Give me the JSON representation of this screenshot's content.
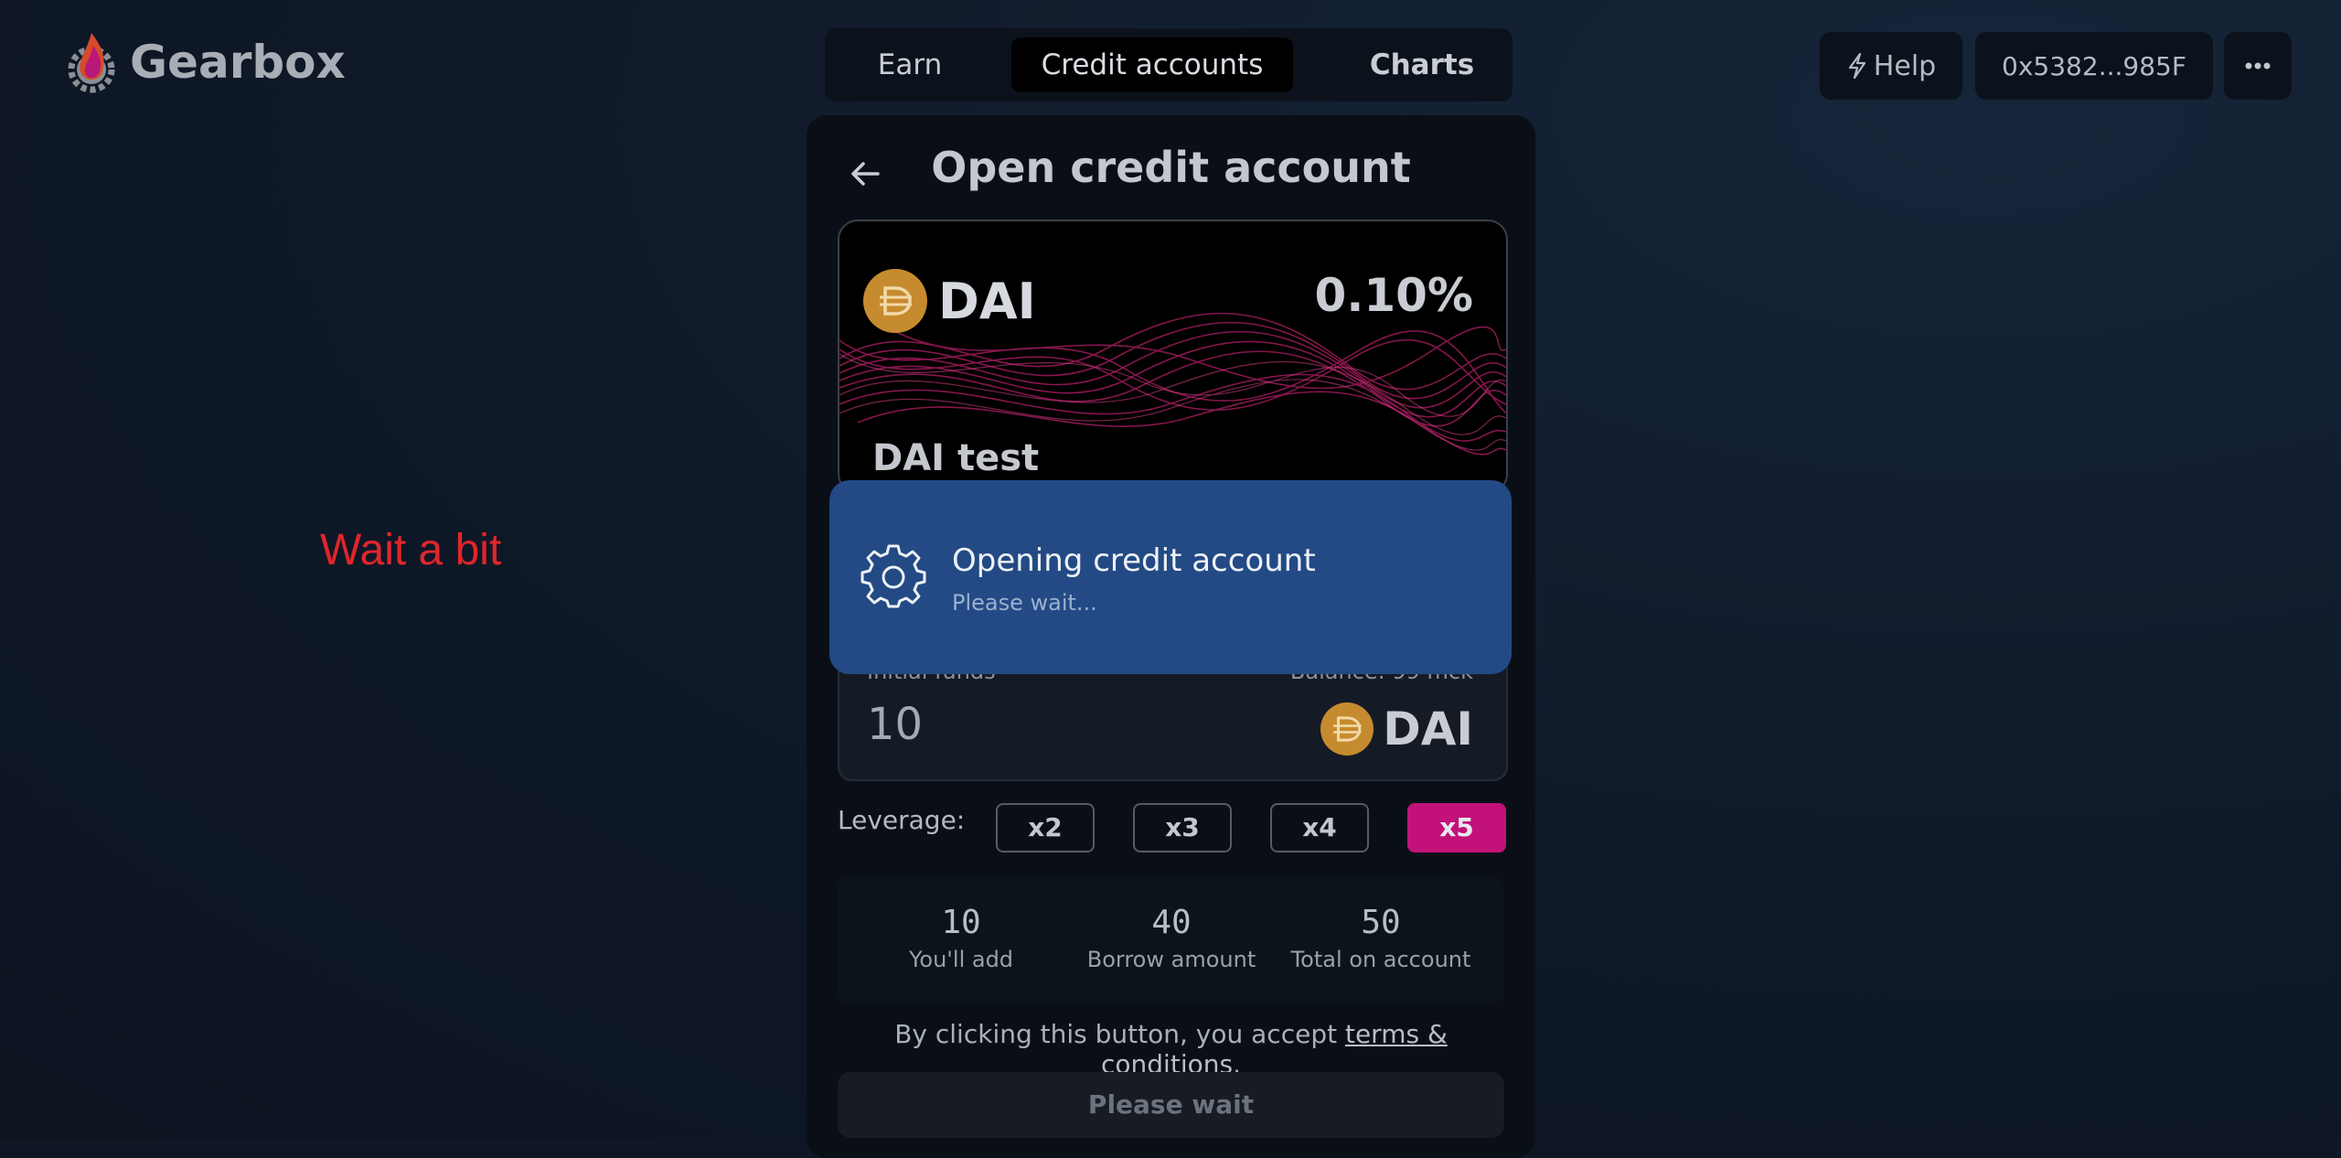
{
  "app": {
    "name": "Gearbox"
  },
  "nav": {
    "tabs": [
      "Earn",
      "Credit accounts",
      "Charts"
    ],
    "active": "Credit accounts"
  },
  "header": {
    "help_label": "Help",
    "wallet_address": "0x5382...985F"
  },
  "annotation": {
    "text": "Wait a bit"
  },
  "panel": {
    "title": "Open credit account",
    "card": {
      "token": "DAI",
      "rate": "0.10%",
      "name": "DAI test"
    },
    "funds": {
      "label": "Initial funds",
      "balance": "Balance: 99 mck",
      "value": "10",
      "token": "DAI"
    },
    "leverage": {
      "label": "Leverage:",
      "options": [
        "x2",
        "x3",
        "x4",
        "x5"
      ],
      "selected": "x5"
    },
    "summary": [
      {
        "value": "10",
        "label": "You'll add"
      },
      {
        "value": "40",
        "label": "Borrow amount"
      },
      {
        "value": "50",
        "label": "Total on account"
      }
    ],
    "terms": {
      "prefix": "By clicking this button, you accept ",
      "link": "terms & conditions",
      "suffix": "."
    },
    "submit_label": "Please wait"
  },
  "toast": {
    "title": "Opening credit account",
    "subtitle": "Please wait..."
  },
  "colors": {
    "accent": "#c2127a",
    "toast_bg": "#234a85",
    "dai_coin": "#c68b2e",
    "annotation": "#e0262a"
  }
}
